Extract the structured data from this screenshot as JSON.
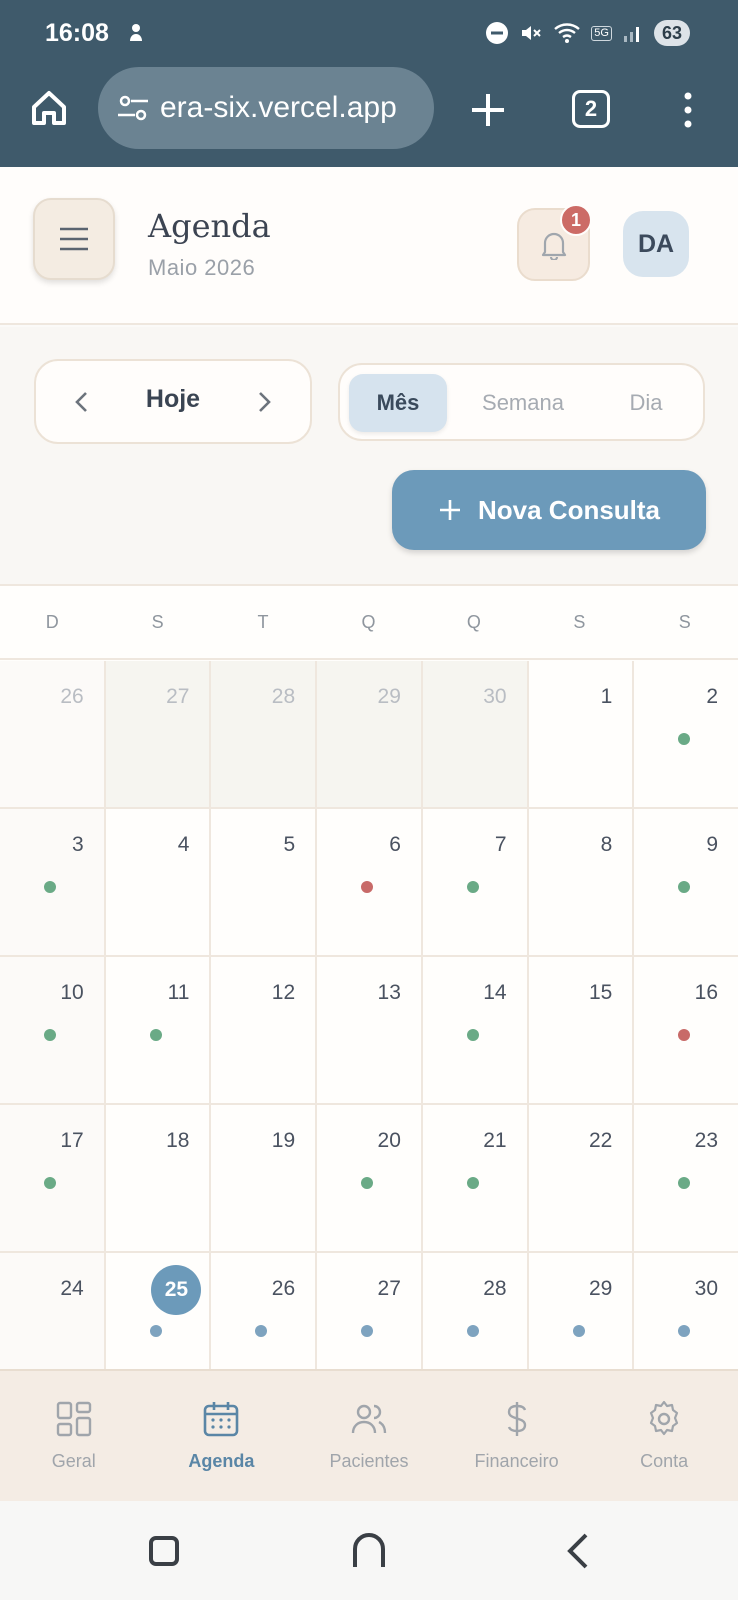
{
  "status_bar": {
    "time": "16:08",
    "battery": "63",
    "network": "5G"
  },
  "browser": {
    "url": "era-six.vercel.app",
    "tab_count": "2"
  },
  "header": {
    "title": "Agenda",
    "subtitle": "Maio 2026",
    "notification_count": "1",
    "avatar_initials": "DA"
  },
  "toolbar": {
    "today_label": "Hoje",
    "views": [
      {
        "label": "Mês",
        "active": true
      },
      {
        "label": "Semana",
        "active": false
      },
      {
        "label": "Dia",
        "active": false
      }
    ],
    "new_label": "Nova Consulta"
  },
  "calendar": {
    "weekdays": [
      "D",
      "S",
      "T",
      "Q",
      "Q",
      "S",
      "S"
    ],
    "today": "25",
    "colors": {
      "green": "#6aaa86",
      "red": "#c86a68",
      "blue": "#7ea3bf"
    },
    "weeks": [
      [
        {
          "d": "26",
          "out": true,
          "dot": null
        },
        {
          "d": "27",
          "out": true,
          "dot": null
        },
        {
          "d": "28",
          "out": true,
          "dot": null
        },
        {
          "d": "29",
          "out": true,
          "dot": null
        },
        {
          "d": "30",
          "out": true,
          "dot": null
        },
        {
          "d": "1",
          "out": false,
          "dot": null
        },
        {
          "d": "2",
          "out": false,
          "dot": "green"
        }
      ],
      [
        {
          "d": "3",
          "out": false,
          "dot": "green"
        },
        {
          "d": "4",
          "out": false,
          "dot": null
        },
        {
          "d": "5",
          "out": false,
          "dot": null
        },
        {
          "d": "6",
          "out": false,
          "dot": "red"
        },
        {
          "d": "7",
          "out": false,
          "dot": "green"
        },
        {
          "d": "8",
          "out": false,
          "dot": null
        },
        {
          "d": "9",
          "out": false,
          "dot": "green"
        }
      ],
      [
        {
          "d": "10",
          "out": false,
          "dot": "green"
        },
        {
          "d": "11",
          "out": false,
          "dot": "green"
        },
        {
          "d": "12",
          "out": false,
          "dot": null
        },
        {
          "d": "13",
          "out": false,
          "dot": null
        },
        {
          "d": "14",
          "out": false,
          "dot": "green"
        },
        {
          "d": "15",
          "out": false,
          "dot": null
        },
        {
          "d": "16",
          "out": false,
          "dot": "red"
        }
      ],
      [
        {
          "d": "17",
          "out": false,
          "dot": "green"
        },
        {
          "d": "18",
          "out": false,
          "dot": null
        },
        {
          "d": "19",
          "out": false,
          "dot": null
        },
        {
          "d": "20",
          "out": false,
          "dot": "green"
        },
        {
          "d": "21",
          "out": false,
          "dot": "green"
        },
        {
          "d": "22",
          "out": false,
          "dot": null
        },
        {
          "d": "23",
          "out": false,
          "dot": "green"
        }
      ],
      [
        {
          "d": "24",
          "out": false,
          "dot": null
        },
        {
          "d": "25",
          "out": false,
          "dot": "blue"
        },
        {
          "d": "26",
          "out": false,
          "dot": "blue"
        },
        {
          "d": "27",
          "out": false,
          "dot": "blue"
        },
        {
          "d": "28",
          "out": false,
          "dot": "blue"
        },
        {
          "d": "29",
          "out": false,
          "dot": "blue"
        },
        {
          "d": "30",
          "out": false,
          "dot": "blue"
        }
      ]
    ]
  },
  "bottom_nav": [
    {
      "label": "Geral",
      "icon": "grid-icon",
      "active": false
    },
    {
      "label": "Agenda",
      "icon": "calendar-icon",
      "active": true
    },
    {
      "label": "Pacientes",
      "icon": "users-icon",
      "active": false
    },
    {
      "label": "Financeiro",
      "icon": "dollar-icon",
      "active": false
    },
    {
      "label": "Conta",
      "icon": "gear-icon",
      "active": false
    }
  ]
}
